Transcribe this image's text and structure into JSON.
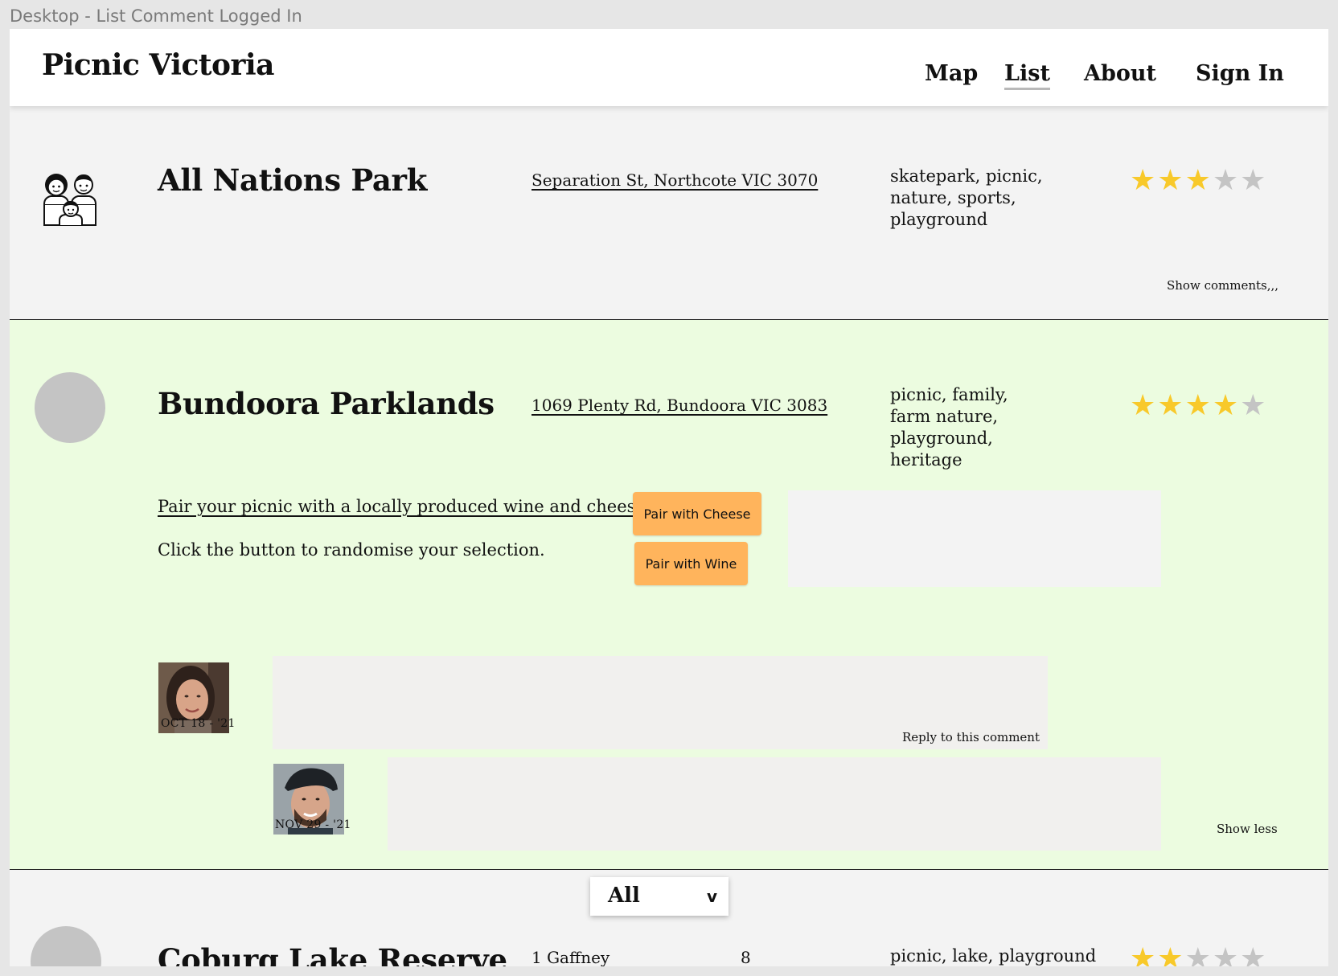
{
  "frame_label": "Desktop - List Comment Logged In",
  "header": {
    "brand": "Picnic Victoria",
    "nav": {
      "map": "Map",
      "list": "List",
      "about": "About",
      "sign_in": "Sign In"
    },
    "active_nav": "List"
  },
  "parks": [
    {
      "name": "All Nations Park",
      "address": "Separation St, Northcote VIC 3070",
      "tags": "skatepark, picnic, nature, sports, playground",
      "rating": 3,
      "max_rating": 5,
      "toggle_label": "Show comments,,,",
      "icon": "family-icon"
    },
    {
      "name": "Bundoora Parklands",
      "address": "1069 Plenty Rd, Bundoora VIC 3083",
      "tags": "picnic, family, farm nature, playground, heritage",
      "rating": 4,
      "max_rating": 5,
      "promo_text": "Pair your picnic with a locally produced wine and cheese...",
      "hint_text": "Click the button to randomise your selection.",
      "buttons": {
        "cheese": "Pair with Cheese",
        "wine": "Pair with Wine"
      },
      "comments": [
        {
          "date": "OCT 18 - '21",
          "reply_label": "Reply to this comment",
          "photo": "user-photo-woman"
        },
        {
          "date": "NOV 29 - '21",
          "photo": "user-photo-man"
        }
      ],
      "toggle_label": "Show less"
    },
    {
      "name": "Coburg Lake Reserve",
      "address_left": "1 Gaffney",
      "address_right": "8",
      "tags": "picnic, lake, playground",
      "rating": 2,
      "max_rating": 5
    }
  ],
  "filter_dropdown": {
    "selected": "All",
    "chevron": "v"
  },
  "colors": {
    "accent_button": "#ffb45c",
    "star_filled": "#f8c92a",
    "star_empty": "#c4c4c4",
    "expanded_row_bg": "#ecfce0"
  }
}
